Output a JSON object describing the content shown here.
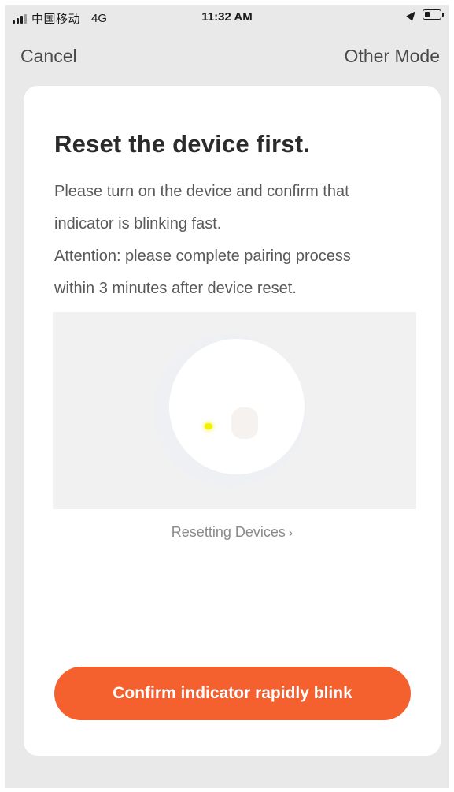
{
  "status_bar": {
    "carrier": "中国移动",
    "network": "4G",
    "time": "11:32 AM",
    "battery_level": 0.35
  },
  "nav": {
    "cancel_label": "Cancel",
    "other_mode_label": "Other Mode"
  },
  "card": {
    "title": "Reset the device first.",
    "description_lines": [
      "Please turn on the device and confirm that",
      "indicator is blinking fast.",
      "Attention: please complete pairing process",
      "within 3 minutes after device reset."
    ],
    "resetting_link_label": "Resetting Devices",
    "resetting_link_chevron": "›",
    "confirm_button_label": "Confirm indicator rapidly blink"
  },
  "colors": {
    "accent": "#f4612f",
    "indicator": "#f2f200",
    "screen_background": "#e9e9e9"
  },
  "icons": {
    "location": "location-arrow-icon",
    "battery": "battery-icon",
    "signal": "signal-strength-icon"
  }
}
